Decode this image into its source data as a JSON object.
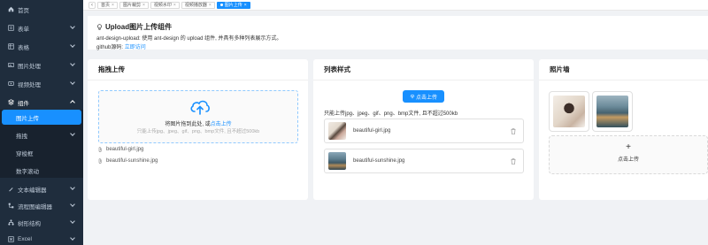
{
  "sidebar": {
    "items": [
      {
        "label": "首页",
        "icon": "home-icon"
      },
      {
        "label": "表单",
        "icon": "form-icon"
      },
      {
        "label": "表格",
        "icon": "table-icon"
      },
      {
        "label": "图片处理",
        "icon": "image-icon"
      },
      {
        "label": "视频处理",
        "icon": "video-icon"
      },
      {
        "label": "组件",
        "icon": "component-icon"
      }
    ],
    "submenu": [
      {
        "label": "图片上传",
        "active": true
      },
      {
        "label": "拖拽"
      },
      {
        "label": "穿梭框"
      },
      {
        "label": "数字滚动"
      }
    ],
    "bottom_items": [
      {
        "label": "文本编辑器",
        "icon": "editor-icon"
      },
      {
        "label": "流程图编辑器",
        "icon": "flow-icon"
      },
      {
        "label": "树形结构",
        "icon": "tree-icon"
      },
      {
        "label": "Excel",
        "icon": "excel-icon"
      }
    ]
  },
  "tabs": {
    "items": [
      {
        "label": "首页"
      },
      {
        "label": "图片裁剪"
      },
      {
        "label": "视频水印"
      },
      {
        "label": "视频播放器"
      },
      {
        "label": "图片上传",
        "active": true
      }
    ]
  },
  "header": {
    "title": "Upload图片上传组件",
    "desc": "ant-design-upload: 使用 ant-design 的 upload 组件, 并具有多种列表展示方式。",
    "git_prefix": "github源码:",
    "git_link": "立即访问"
  },
  "drag_card": {
    "title": "拖拽上传",
    "text_prefix": "将图片拖到此处, 或",
    "text_link": "点击上传",
    "hint": "只能上传jpg、jpeg、gif、png、bmp文件, 且不超过500kb",
    "files": [
      "beautiful-girl.jpg",
      "beautiful-sunshine.jpg"
    ]
  },
  "list_card": {
    "title": "列表样式",
    "button": "点击上传",
    "tip": "只能上传jpg、jpeg、gif、png、bmp文件, 且不超过500kb",
    "files": [
      "beautiful-girl.jpg",
      "beautiful-sunshine.jpg"
    ]
  },
  "wall_card": {
    "title": "照片墙",
    "add_label": "点击上传"
  },
  "colors": {
    "accent": "#1890ff",
    "sidebar_bg": "#1f2d3d"
  }
}
